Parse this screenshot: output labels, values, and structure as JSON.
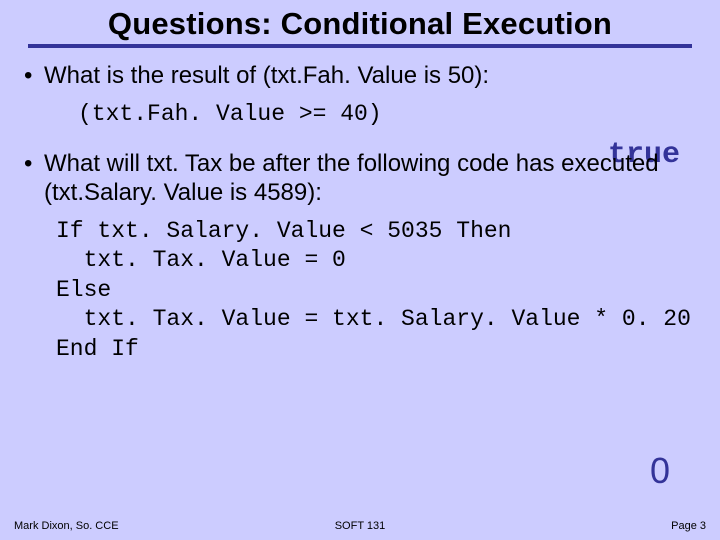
{
  "title": "Questions: Conditional Execution",
  "bullets": {
    "q1": "What is the result of (txt.Fah. Value is 50):",
    "q1_code": "(txt.Fah. Value >= 40)",
    "q1_answer": "true",
    "q2": "What will txt. Tax be after the following code has executed (txt.Salary. Value is 4589):",
    "q2_code": "If txt. Salary. Value < 5035 Then\n  txt. Tax. Value = 0\nElse\n  txt. Tax. Value = txt. Salary. Value * 0. 20\nEnd If",
    "q2_answer": "0"
  },
  "footer": {
    "left": "Mark Dixon, So. CCE",
    "center": "SOFT 131",
    "right": "Page 3"
  }
}
